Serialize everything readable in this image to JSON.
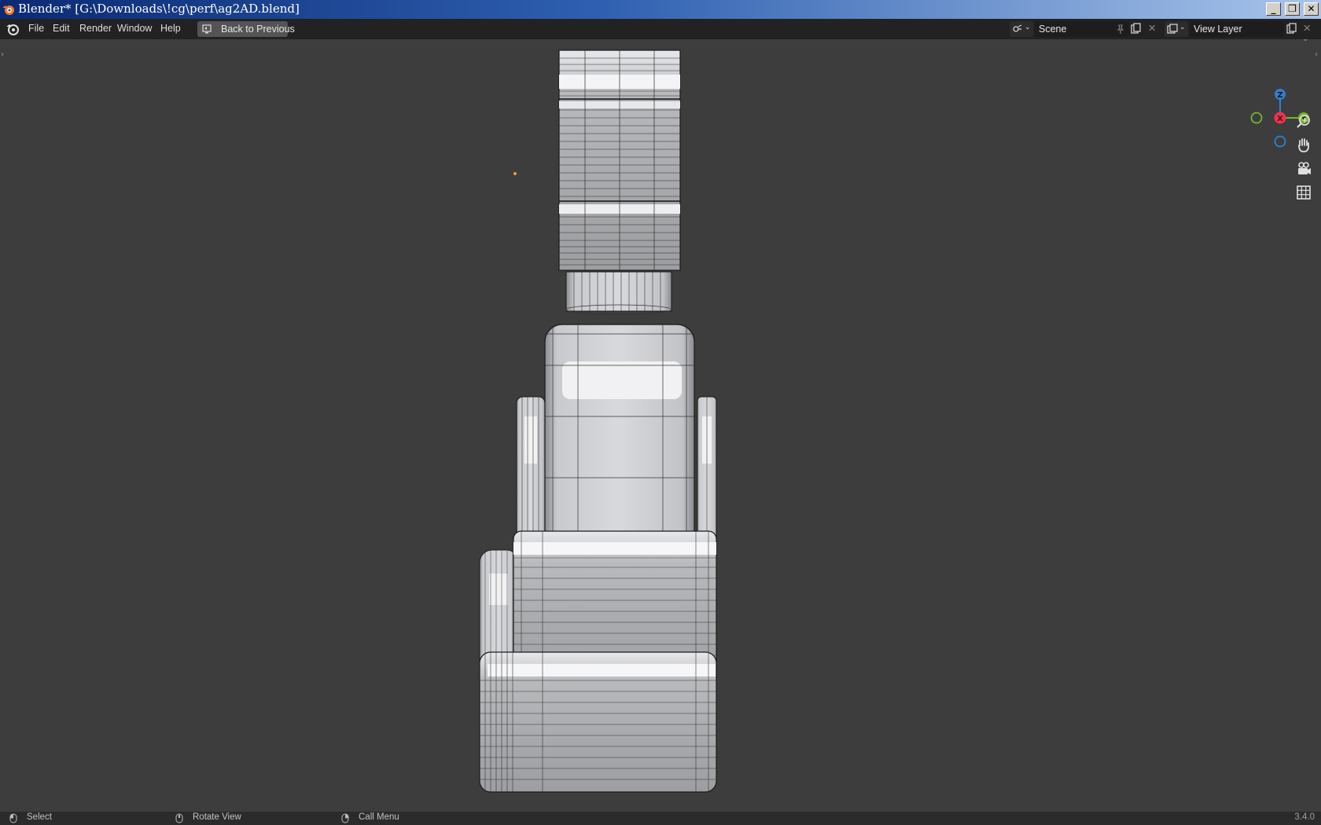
{
  "window": {
    "title": "Blender* [G:\\Downloads\\!cg\\perf\\ag2AD.blend]",
    "controls": {
      "minimize": "_",
      "restore": "❐",
      "close": "✕"
    }
  },
  "menu": {
    "items": [
      "File",
      "Edit",
      "Render",
      "Window",
      "Help"
    ],
    "back_button": "Back to Previous"
  },
  "scene": {
    "name": "Scene"
  },
  "view_layer": {
    "name": "View Layer"
  },
  "gizmo": {
    "x": "X",
    "y": "Y",
    "z": "Z"
  },
  "status": {
    "select": "Select",
    "rotate": "Rotate View",
    "call_menu": "Call Menu",
    "version": "3.4.0"
  },
  "colors": {
    "viewport_bg": "#3d3d3d",
    "axis_x": "#e8344f",
    "axis_y": "#76b52b",
    "axis_z": "#2f80d0",
    "origin_dot": "#f0a030"
  },
  "icons": [
    "blender-logo-icon",
    "back-screen-icon",
    "scene-icon",
    "pin-icon",
    "new-scene-icon",
    "close-icon",
    "view-layer-icon",
    "zoom-icon",
    "hand-icon",
    "camera-icon",
    "grid-icon",
    "mouse-icon"
  ]
}
